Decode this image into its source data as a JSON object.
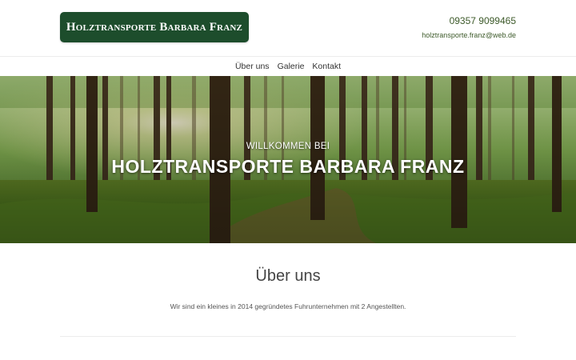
{
  "header": {
    "logo_text": "Holztransporte Barbara Franz",
    "phone": "09357 9099465",
    "email": "holztransporte.franz@web.de"
  },
  "nav": {
    "items": [
      {
        "label": "Über uns"
      },
      {
        "label": "Galerie"
      },
      {
        "label": "Kontakt"
      }
    ]
  },
  "hero": {
    "subtitle": "WILLKOMMEN BEI",
    "title": "HOLZTRANSPORTE BARBARA FRANZ"
  },
  "about": {
    "title": "Über uns",
    "text": "Wir sind ein kleines in 2014 gegründetes Fuhrunternehmen mit 2 Angestellten."
  },
  "colors": {
    "brand": "#1d4d2c",
    "link": "#3d5a2a"
  }
}
